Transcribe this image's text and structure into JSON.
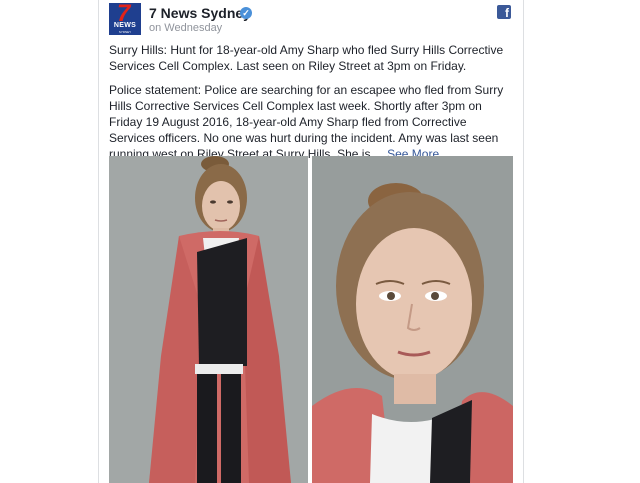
{
  "post": {
    "page_name": "7 News Sydney",
    "timestamp": "on Wednesday",
    "avatar_logo": {
      "number": "7",
      "word": "NEWS",
      "sub": "SYDNEY"
    },
    "headline": "Surry Hills: Hunt for 18-year-old Amy Sharp who fled Surry Hills Corrective Services Cell Complex. Last seen on Riley Street at 3pm on Friday.",
    "body_text": "Police statement: Police are searching for an escapee who fled from Surry Hills Corrective Services Cell Complex last week. Shortly after 3pm on Friday 19 August 2016, 18-year-old Amy Sharp fled from Corrective Services officers. No one was hurt during the incident. Amy was last seen running west on Riley Street at Surry Hills. She is ...",
    "see_more_label": "See More",
    "icons": {
      "verified": "verified-badge-icon",
      "platform": "facebook-icon"
    }
  },
  "photos": {
    "items": [
      {
        "name": "full-length-photo"
      },
      {
        "name": "close-up-photo"
      }
    ]
  },
  "colors": {
    "link": "#365899",
    "meta": "#90949c",
    "brand_blue": "#3b5998",
    "logo_red": "#e2231a"
  }
}
